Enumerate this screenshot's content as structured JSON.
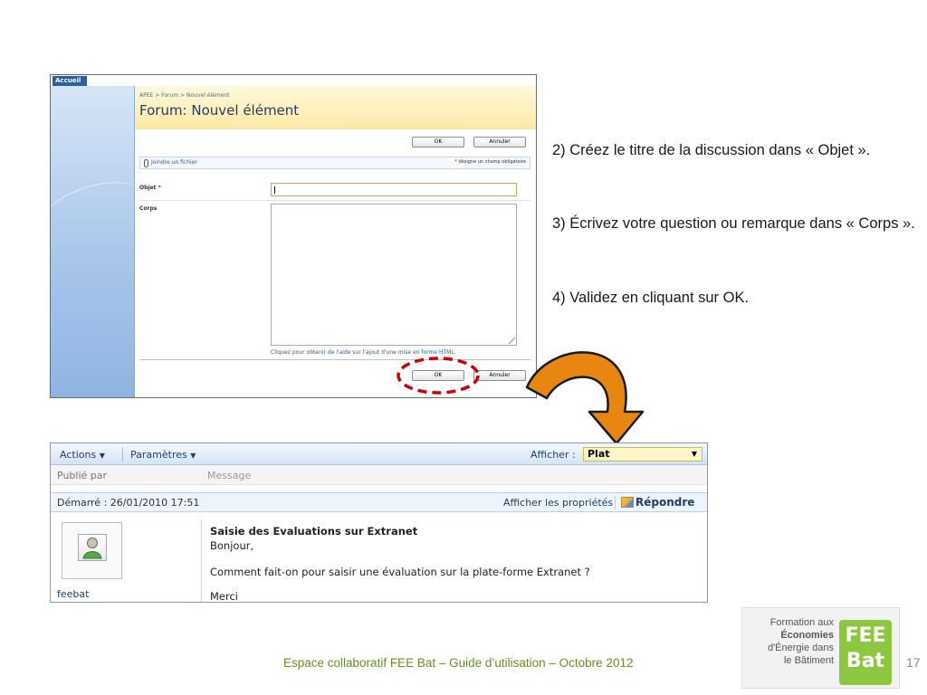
{
  "screenshot1": {
    "tab": "Accueil",
    "breadcrumb": "APEE > Forum > Nouvel élément",
    "title": "Forum: Nouvel élément",
    "ok_label": "OK",
    "cancel_label": "Annuler",
    "attach_label": "Joindre un fichier",
    "required_star": "*",
    "required_note": "désigne un champ obligatoire",
    "field_objet": "Objet",
    "field_corps": "Corps",
    "html_help": "Cliquez pour obtenir de l'aide sur l'ajout d'une mise en forme HTML.",
    "highlight_color": "#cc0000",
    "arrow_color": "#e8870f"
  },
  "instructions": [
    "2) Créez le titre de la discussion dans « Objet ».",
    "3) Écrivez votre question ou remarque dans « Corps ».",
    "4) Validez en cliquant sur OK."
  ],
  "screenshot2": {
    "actions_label": "Actions",
    "params_label": "Paramètres",
    "view_label": "Afficher :",
    "view_value": "Plat",
    "col_published_by": "Publié par",
    "col_message": "Message",
    "started": "Démarré : 26/01/2010 17:51",
    "show_props": "Afficher les propriétés",
    "reply_label": "Répondre",
    "author": "feebat",
    "subject": "Saisie des Evaluations sur Extranet",
    "line1": "Bonjour,",
    "line2": "Comment fait-on pour saisir une évaluation sur la plate-forme Extranet ?",
    "line3": "Merci"
  },
  "footer": {
    "text": "Espace collaboratif FEE Bat – Guide d’utilisation – Octobre 2012",
    "page_number": "17",
    "color": "#6b8e23"
  },
  "logo": {
    "line1": "Formation aux",
    "line2": "Économies",
    "line3": "d'Énergie dans",
    "line4": "le Bâtiment",
    "box_top": "FEE",
    "box_bottom": "Bat",
    "brand_color": "#8dc63f"
  }
}
